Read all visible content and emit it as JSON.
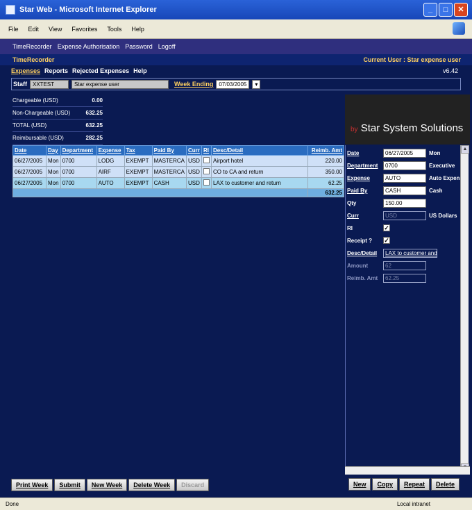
{
  "window": {
    "title": "Star Web - Microsoft Internet Explorer"
  },
  "menu": [
    "File",
    "Edit",
    "View",
    "Favorites",
    "Tools",
    "Help"
  ],
  "nav": [
    "TimeRecorder",
    "Expense Authorisation",
    "Password",
    "Logoff"
  ],
  "app": {
    "name": "TimeRecorder",
    "current_user": "Current User : Star expense user",
    "version": "v6.42"
  },
  "tabs": [
    "Expenses",
    "Reports",
    "Rejected Expenses",
    "Help"
  ],
  "staff": {
    "label": "Staff",
    "code": "XXTEST",
    "name": "Star expense user",
    "week_label": "Week Ending",
    "week_value": "07/03/2005"
  },
  "summary": [
    {
      "label": "Chargeable (USD)",
      "value": "0.00"
    },
    {
      "label": "Non-Chargeable (USD)",
      "value": "632.25"
    },
    {
      "label": "TOTAL (USD)",
      "value": "632.25"
    },
    {
      "label": "Reimbursable (USD)",
      "value": "282.25"
    }
  ],
  "banner": {
    "by": "by",
    "text": "Star System Solutions"
  },
  "grid": {
    "headers": [
      "Date",
      "Day",
      "Department",
      "Expense",
      "Tax",
      "Paid By",
      "Curr",
      "RI",
      "Desc/Detail",
      "Reimb. Amt"
    ],
    "rows": [
      [
        "06/27/2005",
        "Mon",
        "0700",
        "LODG",
        "EXEMPT",
        "MASTERCA",
        "USD",
        "",
        "Airport hotel",
        "220.00"
      ],
      [
        "06/27/2005",
        "Mon",
        "0700",
        "AIRF",
        "EXEMPT",
        "MASTERCA",
        "USD",
        "",
        "CO to CA and return",
        "350.00"
      ],
      [
        "06/27/2005",
        "Mon",
        "0700",
        "AUTO",
        "EXEMPT",
        "CASH",
        "USD",
        "",
        "LAX to customer and return",
        "62.25"
      ]
    ],
    "total": "632.25"
  },
  "detail": {
    "date_label": "Date",
    "date": "06/27/2005",
    "date_desc": "Mon",
    "dept_label": "Department",
    "dept": "0700",
    "dept_desc": "Executive",
    "expense_label": "Expense",
    "expense": "AUTO",
    "expense_desc": "Auto Expense",
    "paidby_label": "Paid By",
    "paidby": "CASH",
    "paidby_desc": "Cash",
    "qty_label": "Qty",
    "qty": "150.00",
    "curr_label": "Curr",
    "curr": "USD",
    "curr_desc": "US Dollars",
    "ri_label": "RI",
    "receipt_label": "Receipt ?",
    "desc_label": "Desc/Detail",
    "desc": "LAX to customer and return",
    "amount_label": "Amount",
    "amount": "62",
    "reimb_label": "Reimb. Amt",
    "reimb": "62.25"
  },
  "buttons_left": [
    "Print Week",
    "Submit",
    "New Week",
    "Delete Week",
    "Discard"
  ],
  "buttons_right": [
    "New",
    "Copy",
    "Repeat",
    "Delete"
  ],
  "status": {
    "left": "Done",
    "zone": "Local intranet"
  }
}
